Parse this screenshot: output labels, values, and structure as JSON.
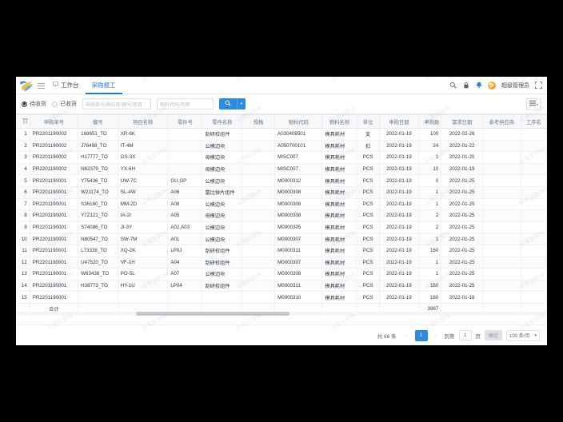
{
  "window": {
    "title": "采购收工"
  },
  "header": {
    "logo_icon": "app-logo-icon",
    "collapse_icon": "menu-collapse-icon",
    "tabs": [
      {
        "label": "工作台",
        "icon": "monitor-icon",
        "active": false
      },
      {
        "label": "采购报工",
        "icon": "",
        "active": true
      }
    ],
    "right": {
      "search_icon": "search-icon",
      "lock_icon": "lock-icon",
      "bell_icon": "bell-icon",
      "avatar_icon": "avatar",
      "username": "超级管理员",
      "fullscreen_icon": "fullscreen-icon"
    }
  },
  "filters": {
    "radios": [
      {
        "label": "待收货",
        "checked": true
      },
      {
        "label": "已收货",
        "checked": false
      }
    ],
    "inputs": [
      {
        "placeholder": "申购单号/供应商/模号/项目",
        "value": ""
      },
      {
        "placeholder": "物料代码/名称",
        "value": ""
      }
    ],
    "search_button_icon": "search-icon",
    "search_dropdown_icon": "caret-down-icon",
    "columns_button_icon": "column-settings-icon"
  },
  "table": {
    "columns": [
      "",
      "申购单号",
      "模号",
      "项目名称",
      "零件号",
      "零件名称",
      "规格",
      "物料代码",
      "物料名称",
      "单位",
      "申购日期",
      "申购数",
      "需求日期",
      "参考供应商",
      "工序名"
    ],
    "rows": [
      {
        "idx": "1",
        "order": "PR2201190002",
        "mold": "168651_TO",
        "proj": "XR-6K",
        "pno": "",
        "pname": "刮研校组件",
        "spec": "",
        "mcode": "A030408501",
        "mname": "模具耗材",
        "unit": "支",
        "date": "2022-01-19",
        "qty": "100",
        "need": "2022-02-26",
        "sup": "",
        "proc": ""
      },
      {
        "idx": "2",
        "order": "PR2201190002",
        "mold": "J78498_TO",
        "proj": "IT-4M",
        "pno": "",
        "pname": "公模边块",
        "spec": "",
        "mcode": "A050700101",
        "mname": "模具耗材",
        "unit": "扣",
        "date": "2022-01-19",
        "qty": "24",
        "need": "2022-01-22",
        "sup": "",
        "proc": ""
      },
      {
        "idx": "3",
        "order": "PR2201190002",
        "mold": "H17777_TO",
        "proj": "GS-3X",
        "pno": "",
        "pname": "母模边块",
        "spec": "",
        "mcode": "MISC007",
        "mname": "模具耗材",
        "unit": "PCS",
        "date": "2022-01-19",
        "qty": "1",
        "need": "2022-01-20",
        "sup": "",
        "proc": ""
      },
      {
        "idx": "4",
        "order": "PR2201190002",
        "mold": "N62379_TO",
        "proj": "YX-6H",
        "pno": "",
        "pname": "母模边块",
        "spec": "",
        "mcode": "MISC007",
        "mname": "模具耗材",
        "unit": "PCS",
        "date": "2022-01-19",
        "qty": "10",
        "need": "2022-01-19",
        "sup": "",
        "proc": ""
      },
      {
        "idx": "5",
        "order": "PR2201190001",
        "mold": "Y75436_TO",
        "proj": "UW-7C",
        "pno": "GU.GP",
        "pname": "公模边块",
        "spec": "",
        "mcode": "M0000312",
        "mname": "模具耗材",
        "unit": "PCS",
        "date": "2022-01-19",
        "qty": "0",
        "need": "2022-01-25",
        "sup": "",
        "proc": ""
      },
      {
        "idx": "6",
        "order": "PR2201190001",
        "mold": "W21174_TO",
        "proj": "SL-4W",
        "pno": "A06",
        "pname": "富比弹片组件",
        "spec": "",
        "mcode": "M0000308",
        "mname": "模具耗材",
        "unit": "PCS",
        "date": "2022-01-19",
        "qty": "1",
        "need": "2022-01-25",
        "sup": "",
        "proc": ""
      },
      {
        "idx": "7",
        "order": "PR2201190001",
        "mold": "S36160_TO",
        "proj": "MM-2D",
        "pno": "A08",
        "pname": "公模边块",
        "spec": "",
        "mcode": "M0000308",
        "mname": "模具耗材",
        "unit": "PCS",
        "date": "2022-01-19",
        "qty": "1",
        "need": "2022-01-25",
        "sup": "",
        "proc": ""
      },
      {
        "idx": "8",
        "order": "PR2201190001",
        "mold": "Y7Z121_TO",
        "proj": "IA-2I",
        "pno": "A05",
        "pname": "母模边块",
        "spec": "",
        "mcode": "M0000308",
        "mname": "模具耗材",
        "unit": "PCS",
        "date": "2022-01-19",
        "qty": "2",
        "need": "2022-01-25",
        "sup": "",
        "proc": ""
      },
      {
        "idx": "9",
        "order": "PR2201190001",
        "mold": "S74086_TO",
        "proj": "JI-3Y",
        "pno": "A02,A03",
        "pname": "公模边块",
        "spec": "",
        "mcode": "M0000305",
        "mname": "模具耗材",
        "unit": "PCS",
        "date": "2022-01-19",
        "qty": "2",
        "need": "2022-01-25",
        "sup": "",
        "proc": ""
      },
      {
        "idx": "10",
        "order": "PR2201190001",
        "mold": "N80547_TO",
        "proj": "SW-7M",
        "pno": "A01",
        "pname": "公模边块",
        "spec": "",
        "mcode": "M0000307",
        "mname": "模具耗材",
        "unit": "PCS",
        "date": "2022-01-19",
        "qty": "1",
        "need": "2022-01-25",
        "sup": "",
        "proc": ""
      },
      {
        "idx": "11",
        "order": "PR2201190001",
        "mold": "L73338_TO",
        "proj": "XQ-2K",
        "pno": "LP0J",
        "pname": "刮研校组件",
        "spec": "",
        "mcode": "M0000311",
        "mname": "模具耗材",
        "unit": "PCS",
        "date": "2022-01-19",
        "qty": "160",
        "need": "2022-01-25",
        "sup": "",
        "proc": ""
      },
      {
        "idx": "12",
        "order": "PR2201190001",
        "mold": "U47520_TO",
        "proj": "VF-1H",
        "pno": "A04",
        "pname": "刮研校组件",
        "spec": "",
        "mcode": "M0000307",
        "mname": "模具耗材",
        "unit": "PCS",
        "date": "2022-01-19",
        "qty": "1",
        "need": "2022-01-25",
        "sup": "",
        "proc": ""
      },
      {
        "idx": "13",
        "order": "PR2201190001",
        "mold": "W63438_TO",
        "proj": "PO-5L",
        "pno": "A07",
        "pname": "公模边块",
        "spec": "",
        "mcode": "M0000308",
        "mname": "模具耗材",
        "unit": "PCS",
        "date": "2022-01-19",
        "qty": "1",
        "need": "2022-01-25",
        "sup": "",
        "proc": ""
      },
      {
        "idx": "14",
        "order": "PR2201190001",
        "mold": "H38773_TO",
        "proj": "HY-1U",
        "pno": "LP04",
        "pname": "刮研校组件",
        "spec": "",
        "mcode": "M0000311",
        "mname": "模具耗材",
        "unit": "PCS",
        "date": "2022-01-19",
        "qty": "160",
        "need": "2022-01-25",
        "sup": "",
        "proc": ""
      },
      {
        "idx": "15",
        "order": "PR2201190001",
        "mold": "",
        "proj": "",
        "pno": "",
        "pname": "",
        "spec": "",
        "mcode": "M0000310",
        "mname": "模具耗材",
        "unit": "PCS",
        "date": "2022-01-19",
        "qty": "160",
        "need": "2022-01-18",
        "sup": "",
        "proc": ""
      }
    ],
    "summary": {
      "label": "合计",
      "qty_total": "3987"
    }
  },
  "pagination": {
    "total_text": "共 66 条",
    "prev_icon": "chevron-left-icon",
    "next_icon": "chevron-right-icon",
    "current_page": "1",
    "goto_label": "到第",
    "goto_value": "1",
    "page_unit": "页",
    "confirm_label": "确定",
    "page_size": "100 条/页",
    "page_size_caret": "chevron-down-icon"
  },
  "watermark": {
    "text": "云易云软件"
  },
  "colors": {
    "accent": "#2b8ae2",
    "header_bg": "#f7f8fa",
    "page_bg": "#000000"
  }
}
